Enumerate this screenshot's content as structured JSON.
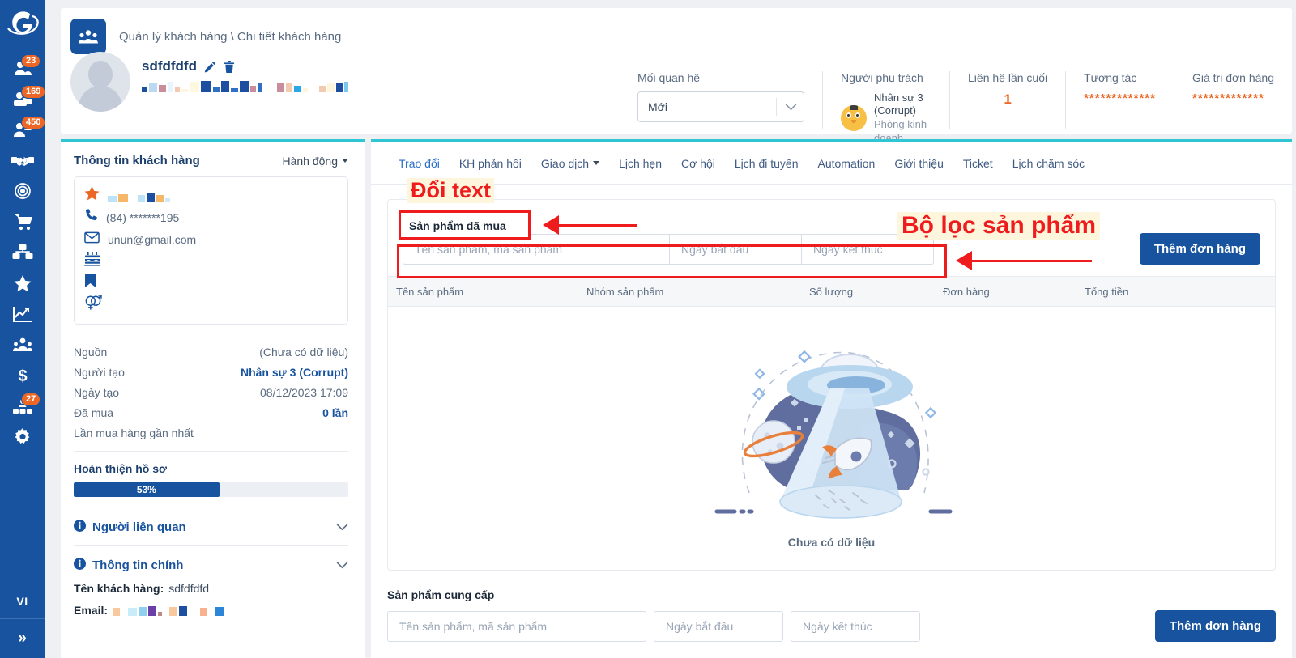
{
  "rail": {
    "logo": "company-logo",
    "items": [
      {
        "name": "customers-icon",
        "badge": "23"
      },
      {
        "name": "leads-icon",
        "badge": "169"
      },
      {
        "name": "contacts-icon",
        "badge": "450"
      },
      {
        "name": "handshake-icon",
        "badge": ""
      },
      {
        "name": "target-icon",
        "badge": ""
      },
      {
        "name": "cart-icon",
        "badge": ""
      },
      {
        "name": "boxes-icon",
        "badge": ""
      },
      {
        "name": "star-icon",
        "badge": ""
      },
      {
        "name": "chart-icon",
        "badge": ""
      },
      {
        "name": "team-icon",
        "badge": ""
      },
      {
        "name": "dollar-icon",
        "badge": ""
      },
      {
        "name": "org-icon",
        "badge": "27"
      },
      {
        "name": "gear-icon",
        "badge": ""
      }
    ],
    "language": "VI",
    "collapse": "»"
  },
  "header": {
    "breadcrumb": "Quản lý khách hàng \\ Chi tiết khách hàng",
    "customer_name": "sdfdfdfd",
    "edit_icon": "pencil-icon",
    "delete_icon": "trash-icon",
    "metrics": {
      "relationship_label": "Mối quan hệ",
      "relationship_value": "Mới",
      "owner_label": "Người phụ trách",
      "owner_name": "Nhân sự 3 (Corrupt)",
      "owner_dept": "Phòng kinh doanh",
      "last_contact_label": "Liên hệ lần cuối",
      "last_contact_value": "1",
      "interaction_label": "Tương tác",
      "interaction_value": "*************",
      "order_value_label": "Giá trị đơn hàng",
      "order_value_value": "*************"
    }
  },
  "left_panel": {
    "title": "Thông tin khách hàng",
    "action_label": "Hành động",
    "contact": {
      "phone": "(84) *******195",
      "email": "unun@gmail.com"
    },
    "details": [
      {
        "key": "Nguồn",
        "value": "(Chưa có dữ liệu)",
        "strong": false
      },
      {
        "key": "Người tạo",
        "value": "Nhân sự 3 (Corrupt)",
        "strong": true
      },
      {
        "key": "Ngày tạo",
        "value": "08/12/2023 17:09",
        "strong": false
      },
      {
        "key": "Đã mua",
        "value": "0 lần",
        "strong": true
      },
      {
        "key": "Lần mua hàng gần nhất",
        "value": "",
        "strong": false
      }
    ],
    "progress_title": "Hoàn thiện hồ sơ",
    "progress_percent": 53,
    "progress_label": "53%",
    "accordion_related": "Người liên quan",
    "accordion_main": "Thông tin chính",
    "field_name_label": "Tên khách hàng:",
    "field_name_value": "sdfdfdfd",
    "field_email_label": "Email:"
  },
  "tabs": [
    {
      "label": "Trao đổi",
      "active": true,
      "dropdown": false
    },
    {
      "label": "KH phản hồi",
      "active": false,
      "dropdown": false
    },
    {
      "label": "Giao dịch",
      "active": false,
      "dropdown": true
    },
    {
      "label": "Lịch hẹn",
      "active": false,
      "dropdown": false
    },
    {
      "label": "Cơ hội",
      "active": false,
      "dropdown": false
    },
    {
      "label": "Lịch đi tuyến",
      "active": false,
      "dropdown": false
    },
    {
      "label": "Automation",
      "active": false,
      "dropdown": false
    },
    {
      "label": "Giới thiệu",
      "active": false,
      "dropdown": false
    },
    {
      "label": "Ticket",
      "active": false,
      "dropdown": false
    },
    {
      "label": "Lịch chăm sóc",
      "active": false,
      "dropdown": false
    }
  ],
  "purchased": {
    "section_title": "Sản phẩm đã mua",
    "filter_name_placeholder": "Tên sản phẩm, mã sản phẩm",
    "filter_start_placeholder": "Ngày bắt đầu",
    "filter_end_placeholder": "Ngày kết thúc",
    "add_button": "Thêm đơn hàng",
    "columns": [
      "Tên sản phẩm",
      "Nhóm sản phẩm",
      "Số lượng",
      "Đơn hàng",
      "Tổng tiền"
    ],
    "rows": [],
    "empty_text": "Chưa có dữ liệu",
    "empty_illustration": "ufo-rocket-illustration"
  },
  "supplied": {
    "section_title": "Sản phẩm cung cấp",
    "filter_name_placeholder": "Tên sản phẩm, mã sản phẩm",
    "filter_start_placeholder": "Ngày bắt đầu",
    "filter_end_placeholder": "Ngày kết thúc",
    "add_button": "Thêm đơn hàng"
  },
  "annotations": {
    "label_change_text": "Đổi text",
    "label_product_filter": "Bộ lọc sản phẩm",
    "boxed_section_title": "Sản phẩm đã mua",
    "color": "#ee1c1c"
  },
  "colors": {
    "sidebar": "#18539f",
    "accent_cyan": "#30c5d2",
    "badge_orange": "#ec6726",
    "primary_button": "#18539f",
    "annotation_red": "#ee1c1c"
  }
}
